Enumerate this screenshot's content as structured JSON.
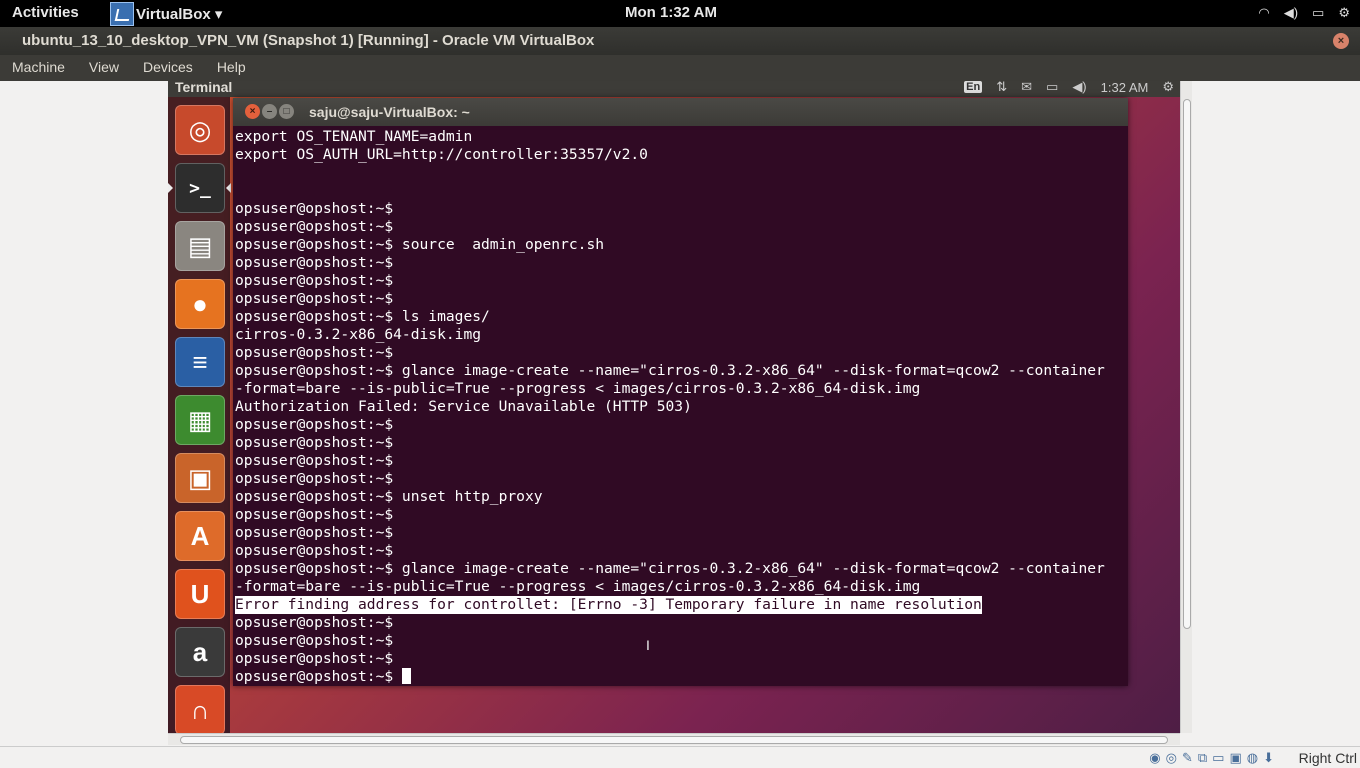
{
  "topbar": {
    "activities": "Activities",
    "app_menu": "VirtualBox ▾",
    "clock": "Mon  1:32 AM",
    "tray": [
      "wifi-icon",
      "volume-icon",
      "battery-icon",
      "gear-icon"
    ]
  },
  "window": {
    "title": "ubuntu_13_10_desktop_VPN_VM (Snapshot 1) [Running] - Oracle VM VirtualBox",
    "close": "×"
  },
  "menu": {
    "machine": "Machine",
    "view": "View",
    "devices": "Devices",
    "help": "Help"
  },
  "guest": {
    "top_title": "Terminal",
    "keyboard": "En",
    "time": "1:32 AM"
  },
  "launcher": {
    "items": [
      {
        "name": "ubuntu-dash",
        "glyph": "◎",
        "color": "#c74a2c"
      },
      {
        "name": "terminal",
        "glyph": ">_",
        "color": "#2d2d2d"
      },
      {
        "name": "files",
        "glyph": "▤",
        "color": "#8a8680"
      },
      {
        "name": "firefox",
        "glyph": "●",
        "color": "#e67320"
      },
      {
        "name": "writer",
        "glyph": "≡",
        "color": "#2a5fa4"
      },
      {
        "name": "calc",
        "glyph": "▦",
        "color": "#3d8b2f"
      },
      {
        "name": "impress",
        "glyph": "▣",
        "color": "#c9642a"
      },
      {
        "name": "software-center",
        "glyph": "A",
        "color": "#de6b2a"
      },
      {
        "name": "ubuntu-one",
        "glyph": "U",
        "color": "#e0521d"
      },
      {
        "name": "amazon",
        "glyph": "a",
        "color": "#3a3a3a"
      },
      {
        "name": "ubuntu-one-music",
        "glyph": "∩",
        "color": "#d84a26"
      }
    ]
  },
  "terminal": {
    "title": "saju@saju-VirtualBox: ~",
    "lines": [
      "export OS_TENANT_NAME=admin",
      "export OS_AUTH_URL=http://controller:35357/v2.0",
      "",
      "",
      "opsuser@opshost:~$",
      "opsuser@opshost:~$",
      "opsuser@opshost:~$ source  admin_openrc.sh",
      "opsuser@opshost:~$",
      "opsuser@opshost:~$",
      "opsuser@opshost:~$",
      "opsuser@opshost:~$ ls images/",
      "cirros-0.3.2-x86_64-disk.img",
      "opsuser@opshost:~$",
      "opsuser@opshost:~$ glance image-create --name=\"cirros-0.3.2-x86_64\" --disk-format=qcow2 --container",
      "-format=bare --is-public=True --progress < images/cirros-0.3.2-x86_64-disk.img",
      "Authorization Failed: Service Unavailable (HTTP 503)",
      "opsuser@opshost:~$",
      "opsuser@opshost:~$",
      "opsuser@opshost:~$",
      "opsuser@opshost:~$",
      "opsuser@opshost:~$ unset http_proxy",
      "opsuser@opshost:~$",
      "opsuser@opshost:~$",
      "opsuser@opshost:~$",
      "opsuser@opshost:~$ glance image-create --name=\"cirros-0.3.2-x86_64\" --disk-format=qcow2 --container",
      "-format=bare --is-public=True --progress < images/cirros-0.3.2-x86_64-disk.img",
      "Error finding address for controllet: [Errno -3] Temporary failure in name resolution",
      "opsuser@opshost:~$",
      "opsuser@opshost:~$",
      "opsuser@opshost:~$",
      "opsuser@opshost:~$ "
    ],
    "highlighted_line_index": 26
  },
  "statusbar": {
    "host_key": "Right Ctrl",
    "icons": [
      "hard-disk-icon",
      "optical-drive-icon",
      "usb-icon",
      "network-icon",
      "shared-folder-icon",
      "display-icon",
      "mouse-integration-icon",
      "host-key-icon"
    ]
  }
}
